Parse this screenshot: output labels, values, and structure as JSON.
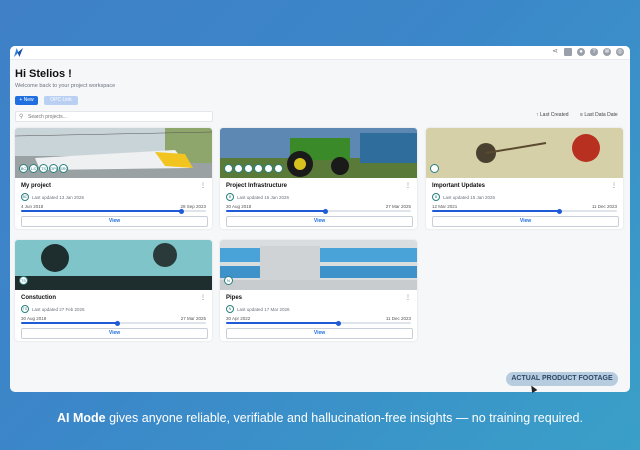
{
  "header": {
    "greeting": "Hi Stelios !",
    "welcome": "Welcome back to your project workspace"
  },
  "actions": {
    "new_label": "+ New",
    "opc_label": "OPC Link"
  },
  "search": {
    "placeholder": "Search projects..."
  },
  "sort": {
    "last_created": "Last Created",
    "last_data_date": "Last Data Date"
  },
  "colors": {
    "accent": "#1f6fe0",
    "progress": "#1f5bd6",
    "teal": "#2a7f7f"
  },
  "top_icons": [
    "share-icon",
    "camera-icon",
    "person-icon",
    "help-icon",
    "settings-icon",
    "profile-icon"
  ],
  "projects": [
    {
      "name": "My project",
      "updated": "Last updated 13 Jan 2026",
      "start": "4 Jun 2018",
      "end": "28 Sep 2023",
      "progress": 0.87,
      "badges": [
        "BC",
        "LS",
        "TS",
        "OPC",
        "SRC"
      ],
      "view": "View"
    },
    {
      "name": "Project Infrastructure",
      "updated": "Last updated 15 Jan 2026",
      "start": "30 Aug 2018",
      "end": "27 Mar 2025",
      "progress": 0.54,
      "badges": [
        "",
        "",
        "",
        "",
        "",
        ""
      ],
      "view": "View"
    },
    {
      "name": "Important Updates",
      "updated": "Last updated 15 Jan 2026",
      "start": "12 Mar 2021",
      "end": "11 Dec 2023",
      "progress": 0.69,
      "badges": [
        ""
      ],
      "view": "View"
    },
    {
      "name": "Constuction",
      "updated": "Last updated 27 Feb 2026",
      "start": "30 Aug 2018",
      "end": "27 Mar 2025",
      "progress": 0.52,
      "badges": [
        "TS"
      ],
      "view": "View"
    },
    {
      "name": "Pipes",
      "updated": "Last updated 17 Mar 2026",
      "start": "30 Apr 2022",
      "end": "11 Dec 2023",
      "progress": 0.61,
      "badges": [
        "N"
      ],
      "view": "View"
    }
  ],
  "overlay": {
    "footage": "ACTUAL PRODUCT FOOTAGE"
  },
  "caption": {
    "bold": "AI Mode",
    "rest": " gives anyone reliable, verifiable and hallucination-free insights — no training required."
  }
}
